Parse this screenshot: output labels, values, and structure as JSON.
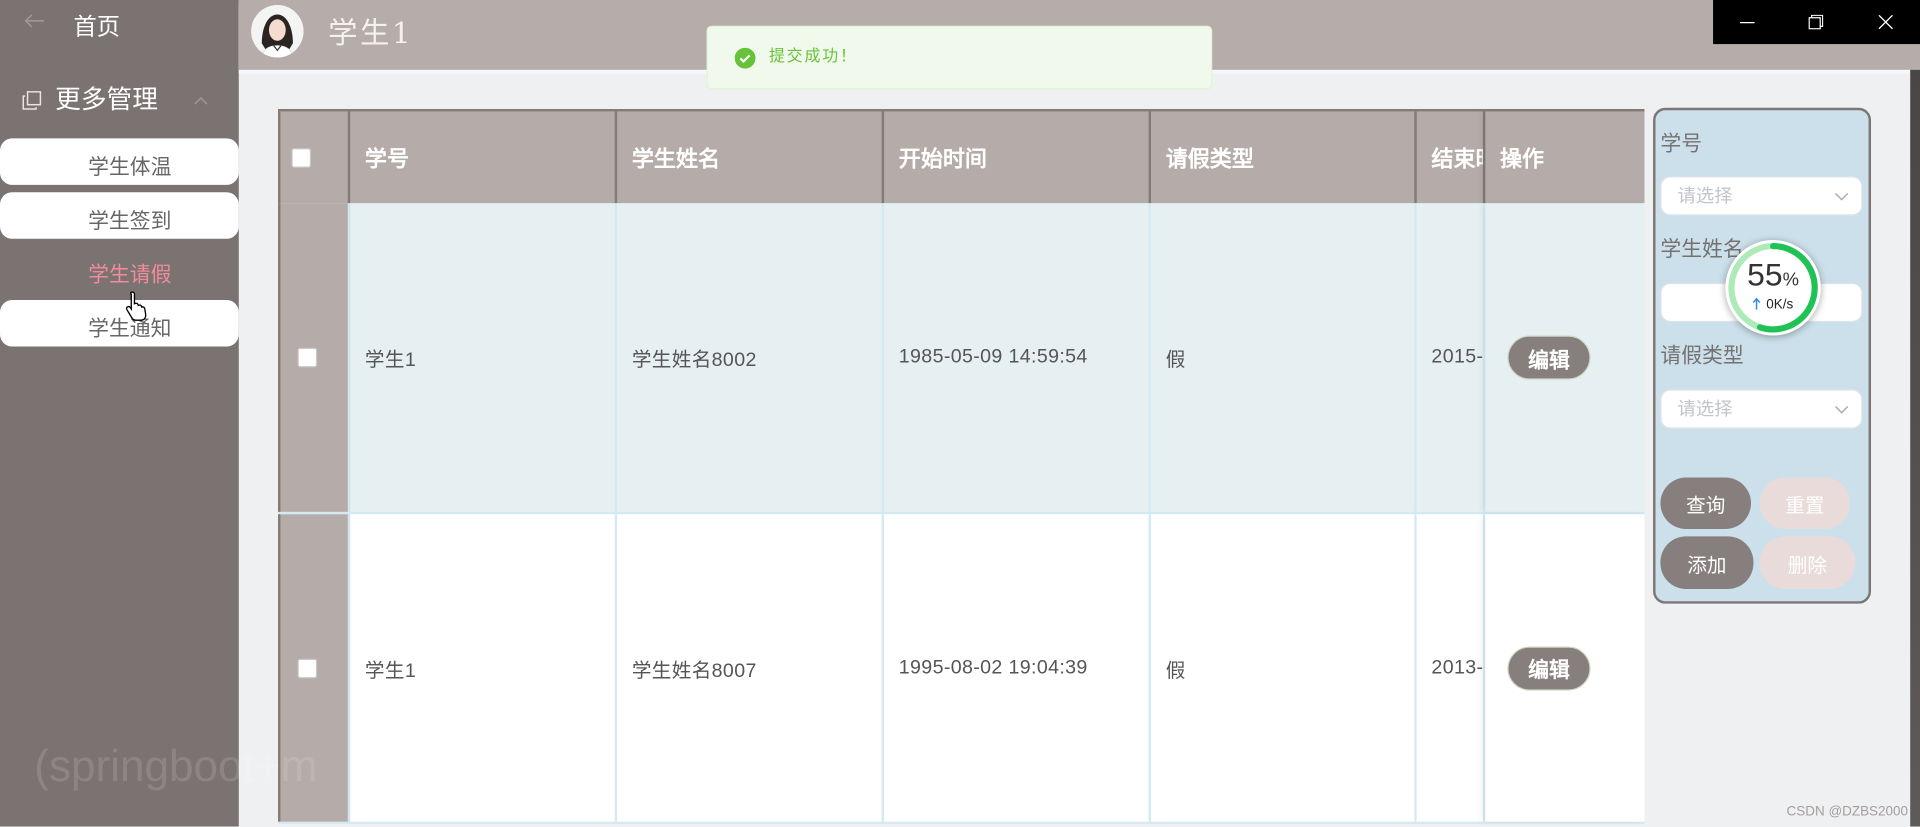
{
  "theme": {
    "sidebar_bg": "#7b7371",
    "header_bg": "#b6aca9",
    "table_header_bg": "#b5aba8",
    "active_text": "#f28b9c",
    "primary_button": "#877f7d",
    "muted_button": "#eadbdb",
    "search_panel_bg": "#cbe0ea",
    "row_highlight_bg": "#e6eff2",
    "success": "#67c23a"
  },
  "window_controls": {
    "icons": [
      "minimize-icon",
      "restore-icon",
      "close-icon"
    ]
  },
  "sidebar": {
    "back_icon": "arrow-left-icon",
    "home_label": "首页",
    "group": {
      "label": "更多管理",
      "icon": "copy-icon",
      "chevron_icon": "chevron-up-icon",
      "expanded": true
    },
    "items": [
      {
        "label": "学生体温",
        "active": false
      },
      {
        "label": "学生签到",
        "active": false
      },
      {
        "label": "学生请假",
        "active": true
      },
      {
        "label": "学生通知",
        "active": false
      }
    ],
    "watermark": "(springboot+m"
  },
  "header": {
    "avatar_icon": "avatar",
    "user_name": "学生1"
  },
  "toast": {
    "icon": "check-circle-icon",
    "message": "提交成功！"
  },
  "table": {
    "select_all_checked": false,
    "columns": [
      "学号",
      "学生姓名",
      "开始时间",
      "请假类型",
      "结束时",
      "操作"
    ],
    "rows": [
      {
        "checked": false,
        "student_no": "学生1",
        "student_name": "学生姓名8002",
        "start_time": "1985-05-09 14:59:54",
        "leave_type": "假",
        "end_time": "2015-",
        "action_label": "编辑"
      },
      {
        "checked": false,
        "student_no": "学生1",
        "student_name": "学生姓名8007",
        "start_time": "1995-08-02 19:04:39",
        "leave_type": "假",
        "end_time": "2013-",
        "action_label": "编辑"
      }
    ]
  },
  "search": {
    "fields": [
      {
        "label": "学号",
        "placeholder": "请选择"
      },
      {
        "label": "学生姓名"
      },
      {
        "label": "请假类型",
        "placeholder": "请选择"
      }
    ],
    "buttons": {
      "query": "查询",
      "reset": "重置",
      "add": "添加",
      "delete": "删除"
    }
  },
  "net_monitor": {
    "percent": 55,
    "percent_unit": "%",
    "speed": "0K/s",
    "arrow_icon": "arrow-up-icon"
  },
  "footer": {
    "watermark": "CSDN @DZBS2000"
  }
}
